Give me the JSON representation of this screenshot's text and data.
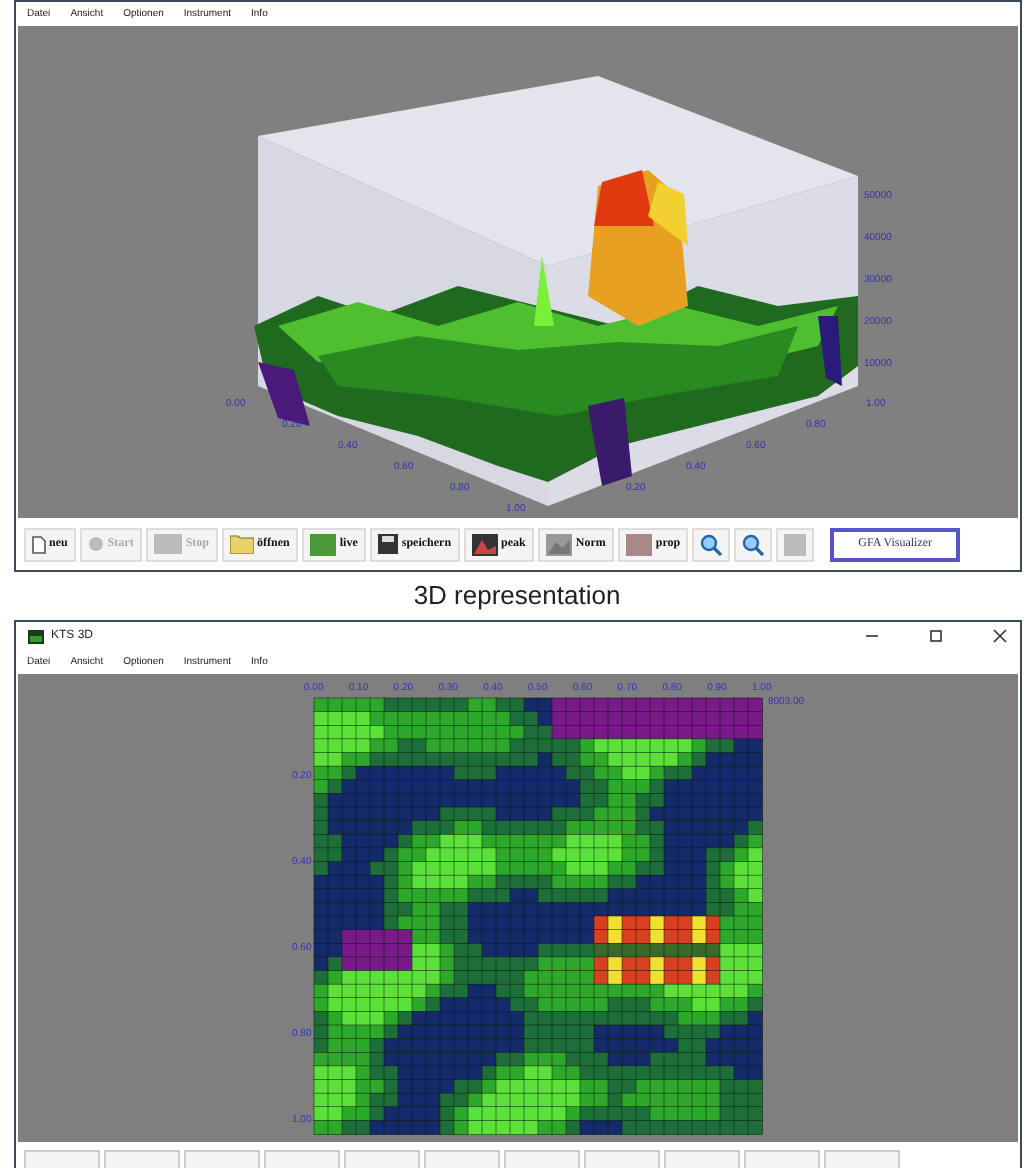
{
  "top_window": {
    "menu": [
      "Datei",
      "Ansicht",
      "Optionen",
      "Instrument",
      "Info"
    ],
    "plot": {
      "z_ticks": [
        "50000",
        "40000",
        "30000",
        "20000",
        "10000"
      ],
      "left_floor_ticks": [
        "0.00",
        "0.20",
        "0.40",
        "0.60",
        "0.80",
        "1.00"
      ],
      "right_floor_ticks": [
        "1.00",
        "0.80",
        "0.60",
        "0.40",
        "0.20"
      ]
    },
    "toolbar": [
      {
        "kind": "document",
        "label": "neu",
        "disabled": false
      },
      {
        "kind": "record",
        "label": "Start",
        "disabled": true
      },
      {
        "kind": "stop",
        "label": "Stop",
        "disabled": true
      },
      {
        "kind": "folder",
        "label": "öffnen",
        "disabled": false
      },
      {
        "kind": "live",
        "label": "live",
        "disabled": false
      },
      {
        "kind": "disk",
        "label": "speichern",
        "disabled": false
      },
      {
        "kind": "peak",
        "label": "peak",
        "disabled": false
      },
      {
        "kind": "norm",
        "label": "Norm",
        "disabled": false
      },
      {
        "kind": "prop",
        "label": "prop",
        "disabled": false
      },
      {
        "kind": "zoom"
      },
      {
        "kind": "zoom"
      },
      {
        "kind": "image",
        "disabled": true
      },
      {
        "kind": "visualizer",
        "label": "GFA Visualizer"
      }
    ]
  },
  "caption": "3D representation",
  "bottom_window": {
    "title": "KTS 3D",
    "menu": [
      "Datei",
      "Ansicht",
      "Optionen",
      "Instrument",
      "Info"
    ],
    "heatmap": {
      "top_ticks": [
        "0.00",
        "0.10",
        "0.20",
        "0.30",
        "0.40",
        "0.50",
        "0.60",
        "0.70",
        "0.80",
        "0.90",
        "1.00"
      ],
      "corner_label": "8003.00",
      "left_ticks": [
        "0.20",
        "0.40",
        "0.60",
        "0.80",
        "1.00"
      ]
    }
  }
}
